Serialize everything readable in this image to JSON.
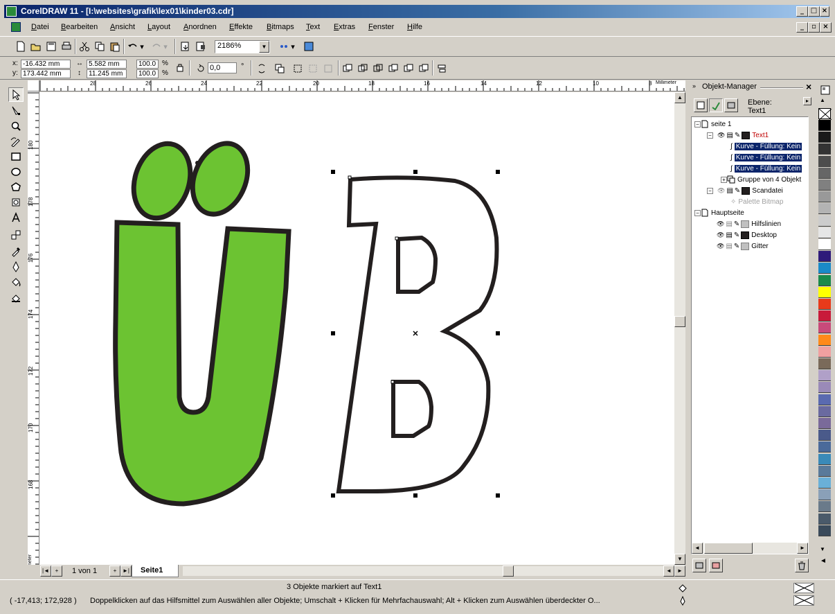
{
  "window": {
    "title": "CorelDRAW 11 - [I:\\websites\\grafik\\lex01\\kinder03.cdr]"
  },
  "menu": {
    "items": [
      "Datei",
      "Bearbeiten",
      "Ansicht",
      "Layout",
      "Anordnen",
      "Effekte",
      "Bitmaps",
      "Text",
      "Extras",
      "Fenster",
      "Hilfe"
    ]
  },
  "toolbar": {
    "zoom": "2186%"
  },
  "property_bar": {
    "x_label": "x:",
    "x_value": "-16.432 mm",
    "y_label": "y:",
    "y_value": "173.442 mm",
    "width": "5.582 mm",
    "height": "11.245 mm",
    "scale_x": "100.0",
    "scale_y": "100.0",
    "percent": "%",
    "angle": "0,0",
    "degree": "°"
  },
  "rulers": {
    "h_labels": [
      "28",
      "26",
      "24",
      "22",
      "20",
      "18",
      "16",
      "14",
      "12",
      "10",
      "8"
    ],
    "h_unit": "Millimeter",
    "v_labels": [
      "180",
      "178",
      "176",
      "174",
      "172",
      "170",
      "168"
    ],
    "v_unit": "Millimeter"
  },
  "pages": {
    "counter": "1 von 1",
    "tab": "Seite1"
  },
  "object_manager": {
    "title": "Objekt-Manager",
    "layer_label": "Ebene:",
    "layer_value": "Text1",
    "tree": [
      {
        "label": "seite 1"
      },
      {
        "label": "Text1"
      },
      {
        "label": "Kurve - Füllung: Kein"
      },
      {
        "label": "Kurve - Füllung: Kein"
      },
      {
        "label": "Kurve - Füllung: Kein"
      },
      {
        "label": "Gruppe von 4 Objekt"
      },
      {
        "label": "Scandatei"
      },
      {
        "label": "Palette Bitmap"
      },
      {
        "label": "Hauptseite"
      },
      {
        "label": "Hilfslinien"
      },
      {
        "label": "Desktop"
      },
      {
        "label": "Gitter"
      }
    ]
  },
  "palette": {
    "colors": [
      "#000000",
      "#1a1a1a",
      "#333333",
      "#4d4d4d",
      "#666666",
      "#808080",
      "#999999",
      "#b3b3b3",
      "#cccccc",
      "#e6e6e6",
      "#ffffff",
      "#2e1a7a",
      "#1a8ac8",
      "#1a8a4a",
      "#ffff00",
      "#e83a1a",
      "#c81a3a",
      "#c84a7a",
      "#ff8a1a",
      "#f0a0a0",
      "#7a6a5a",
      "#b0a0c8",
      "#9a8ab8",
      "#5a6ab0",
      "#6a6aa0",
      "#7a6a9a",
      "#4a5a8a",
      "#4a6a9a",
      "#3a8ab8",
      "#5a7a9a",
      "#6ab0d8",
      "#8aa0b8",
      "#6a7a8a",
      "#4a5a6a",
      "#3a4a5a"
    ]
  },
  "status": {
    "selection": "3 Objekte markiert auf Text1",
    "coords": "( -17,413; 172,928 )",
    "hint": "Doppelklicken auf das Hilfsmittel zum Auswählen aller Objekte; Umschalt + Klicken für Mehrfachauswahl; Alt + Klicken zum Auswählen überdeckter O..."
  },
  "colors": {
    "letter_fill": "#6cc332",
    "outline": "#231f1f",
    "selection_bg": "#0a246a"
  }
}
